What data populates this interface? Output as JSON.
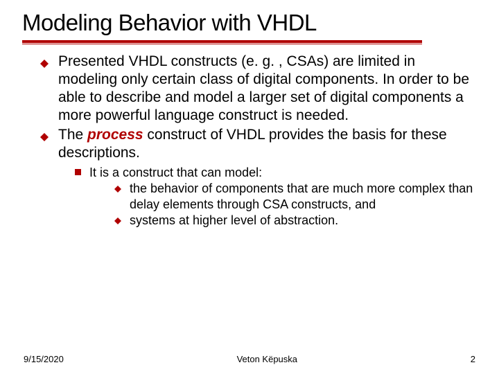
{
  "title": "Modeling Behavior with VHDL",
  "bullets": {
    "b1": "Presented VHDL constructs (e. g. , CSAs) are limited in modeling only certain class of digital components. In order to be able to describe and model a larger set of digital components a more powerful language construct is needed.",
    "b2a": "The ",
    "b2_emph": "process",
    "b2b": " construct of VHDL provides the basis for these  descriptions.",
    "sub_intro": "It is a construct that can model:",
    "sub1": "the behavior of components that are much more complex than delay elements through CSA constructs, and",
    "sub2": "systems at higher level of abstraction."
  },
  "footer": {
    "date": "9/15/2020",
    "author": "Veton Këpuska",
    "page": "2"
  }
}
